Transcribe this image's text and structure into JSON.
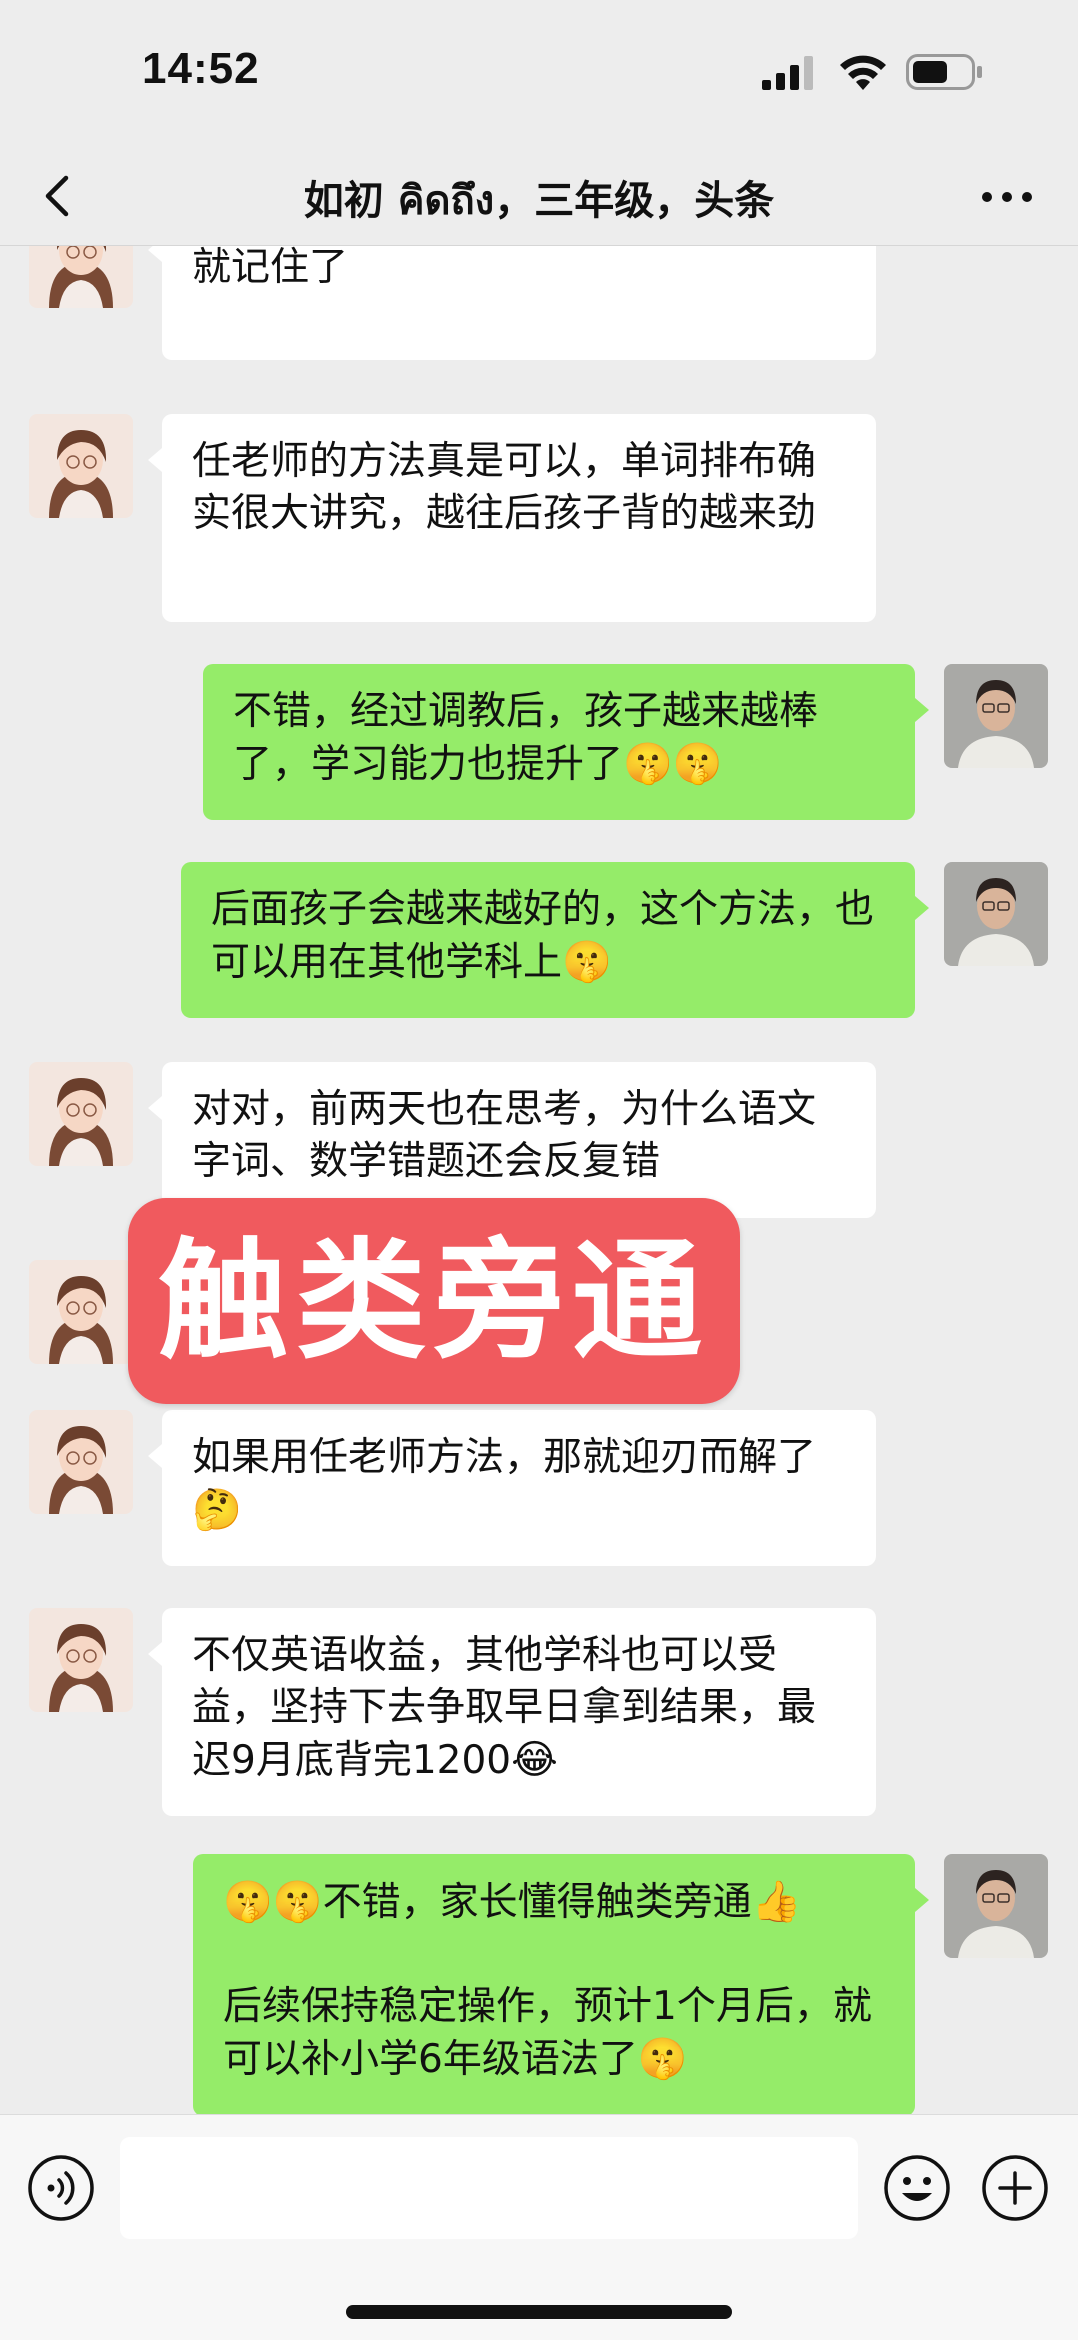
{
  "status_bar": {
    "time": "14:52"
  },
  "nav": {
    "title": "如初 คิดถึง，三年级，头条"
  },
  "messages": [
    {
      "dir": "in",
      "text": "娃自己说越背越简单，联想前面单词就记住了",
      "emoji": ""
    },
    {
      "dir": "in",
      "text": "任老师的方法真是可以，单词排布确实很大讲究，越往后孩子背的越来劲",
      "emoji": ""
    },
    {
      "dir": "out",
      "text": "不错，经过调教后，孩子越来越棒了，学习能力也提升了",
      "emoji": "🤫🤫"
    },
    {
      "dir": "out",
      "text": "后面孩子会越来越好的，这个方法，也可以用在其他学科上",
      "emoji": "🤫"
    },
    {
      "dir": "in",
      "text": "对对，前两天也在思考，为什么语文字词、数学错题还会反复错",
      "emoji": ""
    },
    {
      "dir": "in",
      "text": "如果用任老师方法，那就迎刃而解了",
      "emoji": "🤔"
    },
    {
      "dir": "in",
      "text": "不仅英语收益，其他学科也可以受益，坚持下去争取早日拿到结果，最迟9月底背完1200",
      "emoji": "😂"
    },
    {
      "dir": "out",
      "lead_emoji": "🤫🤫",
      "text": "不错，家长懂得触类旁通",
      "emoji": "👍",
      "text2": "后续保持稳定操作，预计1个月后，就可以补小学6年级语法了",
      "emoji2": "🤫"
    }
  ],
  "overlay": {
    "text": "触类旁通"
  },
  "input_bar": {
    "placeholder": ""
  },
  "colors": {
    "outgoing_bubble": "#95ec69",
    "incoming_bubble": "#ffffff",
    "background": "#ededed",
    "banner": "#f05a5e"
  }
}
